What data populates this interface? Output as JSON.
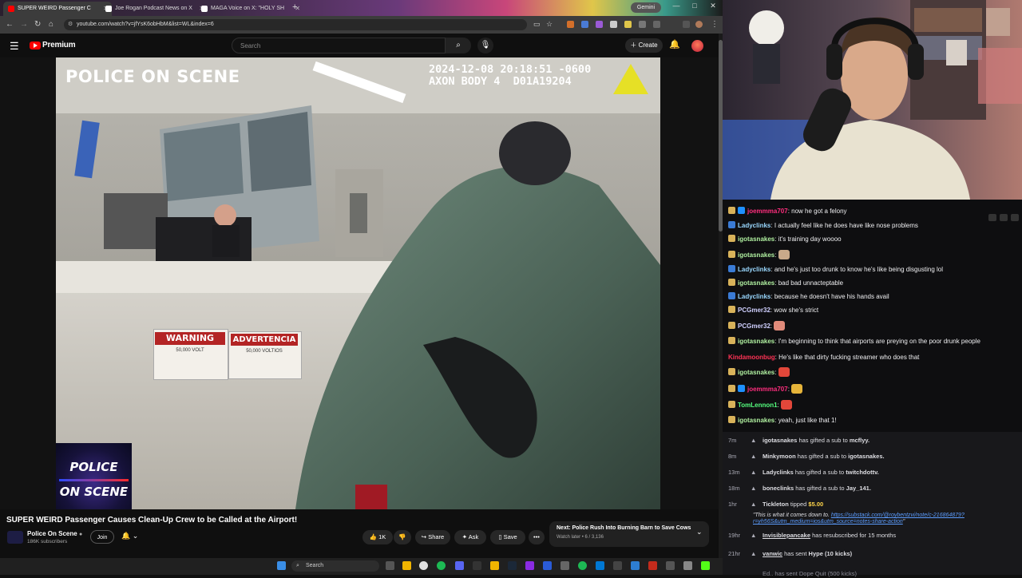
{
  "browser": {
    "tabs": [
      {
        "title": "SUPER WEIRD Passenger C",
        "color": "#ff0000",
        "active": true
      },
      {
        "title": "Joe Rogan Podcast News on X",
        "color": "#ffffff",
        "active": false
      },
      {
        "title": "MAGA Voice on X: \"HOLY SH",
        "color": "#ffffff",
        "active": false
      }
    ],
    "new_tab": "+",
    "gemini_label": "Gemini",
    "url": "youtube.com/watch?v=jfYsK6obHbM&list=WL&index=6",
    "window_controls": [
      "—",
      "□",
      "✕"
    ]
  },
  "youtube": {
    "brand": "Premium",
    "search_placeholder": "Search",
    "create_label": "Create",
    "video": {
      "watermark": "POLICE ON SCENE",
      "timestamp": "2024-12-08 20:18:51 -0600\nAXON BODY 4  D01A19204",
      "warning_en": "WARNING",
      "warning_es": "ADVERTENCIA",
      "volt_en": "50,000 VOLT",
      "volt_es": "50,000 VOLTIOS",
      "logo_line1": "POLICE",
      "logo_line2": "ON SCENE"
    },
    "title": "SUPER WEIRD Passenger Causes Clean-Up Crew to be Called at the Airport!",
    "channel": "Police On Scene",
    "subscribers": "186K subscribers",
    "join_label": "Join",
    "likes": "1K",
    "share_label": "Share",
    "ask_label": "Ask",
    "save_label": "Save",
    "more_label": "•••",
    "next": {
      "title": "Next: Police Rush Into Burning Barn to Save Cows",
      "subtitle": "Watch later • 6 / 3,136"
    }
  },
  "taskbar": {
    "search_label": "Search"
  },
  "chat": {
    "messages": [
      {
        "user": "joemmma707",
        "color": "#ff2e7e",
        "text": "now he got a felony",
        "badge1": "#d8b25a",
        "badge2": "#1e90ff"
      },
      {
        "user": "Ladyclinks",
        "color": "#9ad8ff",
        "text": "I actually feel like he does have like nose problems",
        "badge1": "#3a7bd5",
        "badge2": ""
      },
      {
        "user": "igotasnakes",
        "color": "#b0f0a0",
        "text": "it's training day woooo",
        "badge1": "#d8b25a",
        "badge2": ""
      },
      {
        "user": "igotasnakes",
        "color": "#b0f0a0",
        "text": "",
        "emote": "#c9a98a",
        "badge1": "#d8b25a",
        "badge2": ""
      },
      {
        "user": "Ladyclinks",
        "color": "#9ad8ff",
        "text": "and he's just too drunk to know he's like being disgusting lol",
        "badge1": "#3a7bd5",
        "badge2": ""
      },
      {
        "user": "igotasnakes",
        "color": "#b0f0a0",
        "text": "bad bad unnacteptable",
        "badge1": "#d8b25a",
        "badge2": ""
      },
      {
        "user": "Ladyclinks",
        "color": "#9ad8ff",
        "text": "because he doesn't have his hands avail",
        "badge1": "#3a7bd5",
        "badge2": ""
      },
      {
        "user": "PCGmer32",
        "color": "#d0d0ff",
        "text": "wow she's strict",
        "badge1": "#d8b25a",
        "badge2": ""
      },
      {
        "user": "PCGmer32",
        "color": "#d0d0ff",
        "text": "",
        "emote": "#e08a7a",
        "badge1": "#d8b25a",
        "badge2": ""
      },
      {
        "user": "igotasnakes",
        "color": "#b0f0a0",
        "text": "I'm beginning to think that airports are preying on the poor drunk people",
        "badge1": "#d8b25a",
        "badge2": ""
      },
      {
        "user": "Kindamoonbug",
        "color": "#ff3355",
        "text": "He's like that dirty fucking streamer who does that",
        "badge1": "",
        "badge2": ""
      },
      {
        "user": "igotasnakes",
        "color": "#b0f0a0",
        "text": "",
        "emote": "#e2473a",
        "badge1": "#d8b25a",
        "badge2": ""
      },
      {
        "user": "joemmma707",
        "color": "#ff2e7e",
        "text": "",
        "emote": "#e6b43a",
        "badge1": "#d8b25a",
        "badge2": "#1e90ff"
      },
      {
        "user": "TomLennon1",
        "color": "#55ff7f",
        "text": "",
        "emote": "#e2473a",
        "badge1": "#d8b25a",
        "badge2": ""
      },
      {
        "user": "igotasnakes",
        "color": "#b0f0a0",
        "text": "yeah, just like that 1!",
        "badge1": "#d8b25a",
        "badge2": ""
      }
    ],
    "events": [
      {
        "time": "7m",
        "user": "igotasnakes",
        "action": "has gifted a sub to",
        "target": "mcflyy."
      },
      {
        "time": "8m",
        "user": "Minkymoon",
        "action": "has gifted a sub to",
        "target": "igotasnakes."
      },
      {
        "time": "13m",
        "user": "Ladyclinks",
        "action": "has gifted a sub to",
        "target": "twitchdottv."
      },
      {
        "time": "18m",
        "user": "boneclinks",
        "action": "has gifted a sub to",
        "target": "Jay_141."
      },
      {
        "time": "1hr",
        "user": "Tickleton",
        "action": "tipped",
        "target": "$5.00"
      },
      {
        "time": "19hr",
        "user": "Invisiblepancake",
        "action": "has resubscribed for 15 months",
        "target": ""
      },
      {
        "time": "21hr",
        "user": "vanwic",
        "action": "has sent",
        "target": "Hype (10 kicks)"
      }
    ],
    "tip_message": "\"This is what it comes down to.",
    "tip_link_1": "https://substack.com/@roybentzvi/note/c-216864879?",
    "tip_link_2": "r=yh56S&utm_medium=ios&utm_source=notes-share-action",
    "tip_end": "\"",
    "partial_last": "Ed.. has sent Dope Quit (500 kicks)"
  }
}
